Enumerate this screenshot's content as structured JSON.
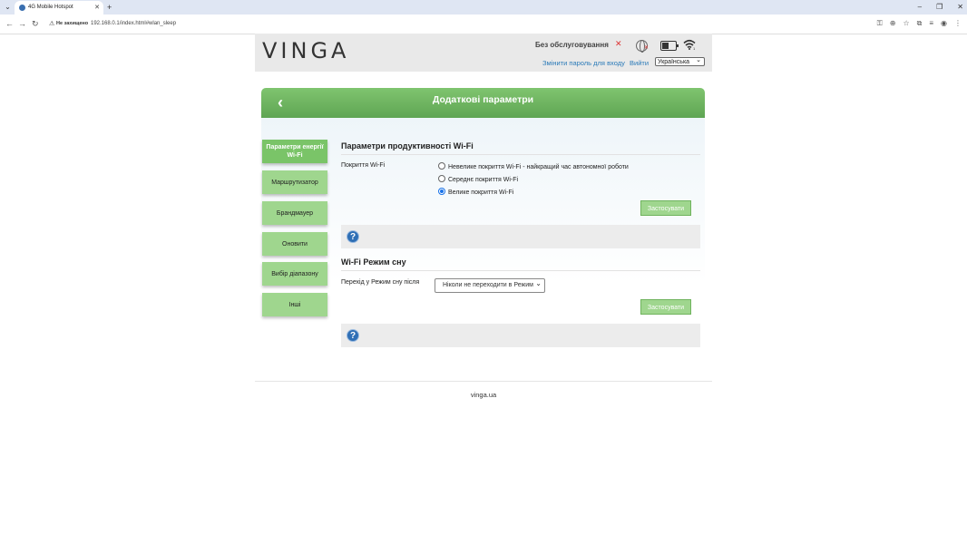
{
  "browser": {
    "tab_title": "4G Mobile Hotspot",
    "new_tab": "+",
    "security_label": "Не захищено",
    "url": "192.168.0.1/index.html#wlan_sleep"
  },
  "header": {
    "logo": "VINGA",
    "service_status": "Без обслуговування",
    "change_password": "Змінити пароль для входу",
    "logout": "Вийти",
    "language": "Українська"
  },
  "page": {
    "title": "Додаткові параметри",
    "back": "‹"
  },
  "sidebar": {
    "items": [
      {
        "label": "Параметри енергії Wi-Fi",
        "active": true
      },
      {
        "label": "Маршрутизатор",
        "active": false
      },
      {
        "label": "Брандмауер",
        "active": false
      },
      {
        "label": "Оновити",
        "active": false
      },
      {
        "label": "Вибір діапазону",
        "active": false
      },
      {
        "label": "Інші",
        "active": false
      }
    ]
  },
  "performance": {
    "title": "Параметри продуктивності Wi-Fi",
    "coverage_label": "Покриття Wi-Fi",
    "options": [
      {
        "label": "Невелике покриття Wi-Fi - найкращий час автономної роботи",
        "selected": false
      },
      {
        "label": "Середнє покриття Wi-Fi",
        "selected": false
      },
      {
        "label": "Велике покриття Wi-Fi",
        "selected": true
      }
    ],
    "apply": "Застосувати"
  },
  "sleep": {
    "title": "Wi-Fi Режим сну",
    "label": "Перехід у Режим сну після",
    "value": "Ніколи не переходити в Режим",
    "apply": "Застосувати"
  },
  "help_symbol": "?",
  "footer": {
    "text": "vinga.ua"
  },
  "colors": {
    "accent_green": "#7ac468",
    "link_blue": "#2a7ab8",
    "help_blue": "#2f6fb5"
  }
}
